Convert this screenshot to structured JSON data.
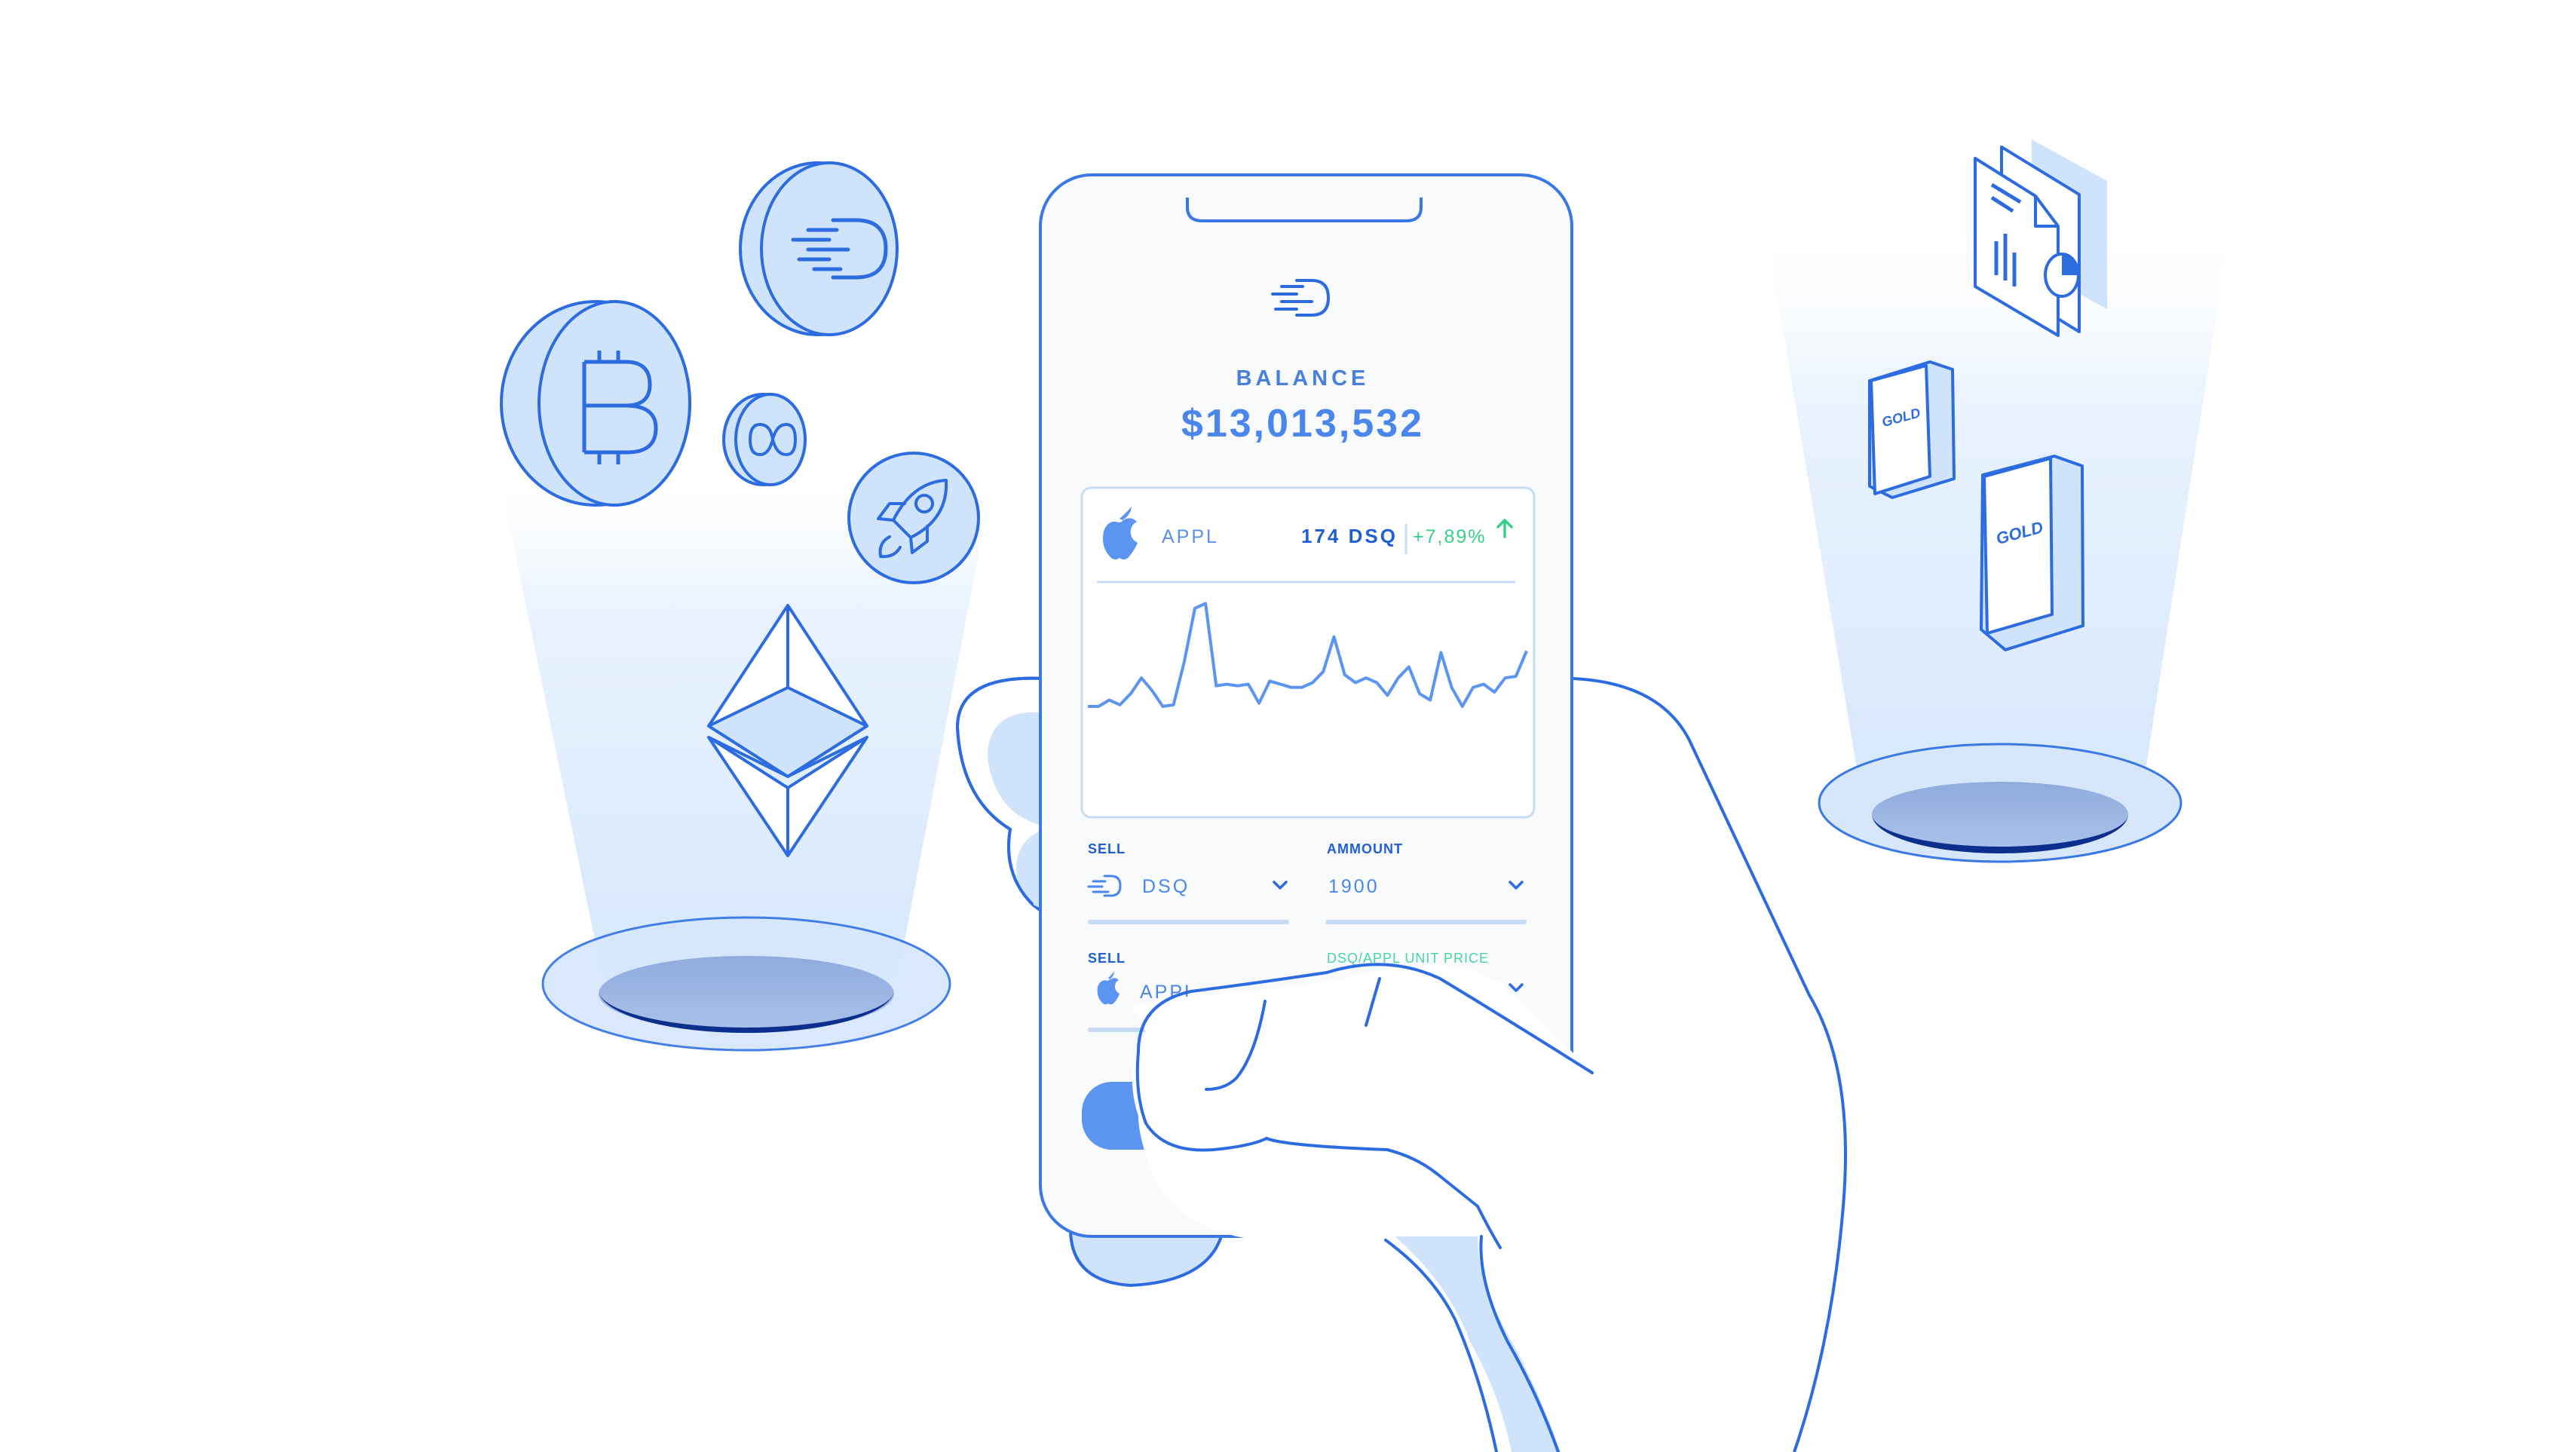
{
  "app": {
    "balance_label": "BALANCE",
    "balance_value": "$13,013,532"
  },
  "stock_card": {
    "name": "APPL",
    "quantity": "174 DSQ",
    "change": "+7,89%",
    "change_direction": "up"
  },
  "chart_data": {
    "type": "line",
    "title": "",
    "values": [
      30,
      30,
      34,
      31,
      38,
      48,
      40,
      30,
      31,
      58,
      92,
      95,
      43,
      44,
      43,
      44,
      32,
      46,
      44,
      42,
      42,
      45,
      52,
      74,
      50,
      45,
      48,
      45,
      37,
      48,
      55,
      38,
      34,
      64,
      42,
      30,
      42,
      44,
      39,
      48,
      49,
      65
    ]
  },
  "form": {
    "sell_label": "SELL",
    "sell_value": "DSQ",
    "amount_label": "AMMOUNT",
    "amount_value": "1900",
    "sell2_label": "SELL",
    "sell2_value": "APPL",
    "unit_price_label": "DSQ/APPL UNIT PRICE"
  },
  "icons": {
    "coins": [
      "bitcoin-coin-icon",
      "dsq-coin-icon",
      "infinity-coin-icon",
      "rocket-coin-icon",
      "ethereum-icon"
    ],
    "assets": [
      "document-chart-icon",
      "gold-bar-icon",
      "gold-bar-icon"
    ],
    "gold_label": "GOLD"
  },
  "colors": {
    "line_blue": "#2d6ce0",
    "fill_blue": "#cfe3fb",
    "button_blue": "#5b95f1",
    "positive_green": "#36d08b",
    "phone_bg": "#f9fafb"
  }
}
